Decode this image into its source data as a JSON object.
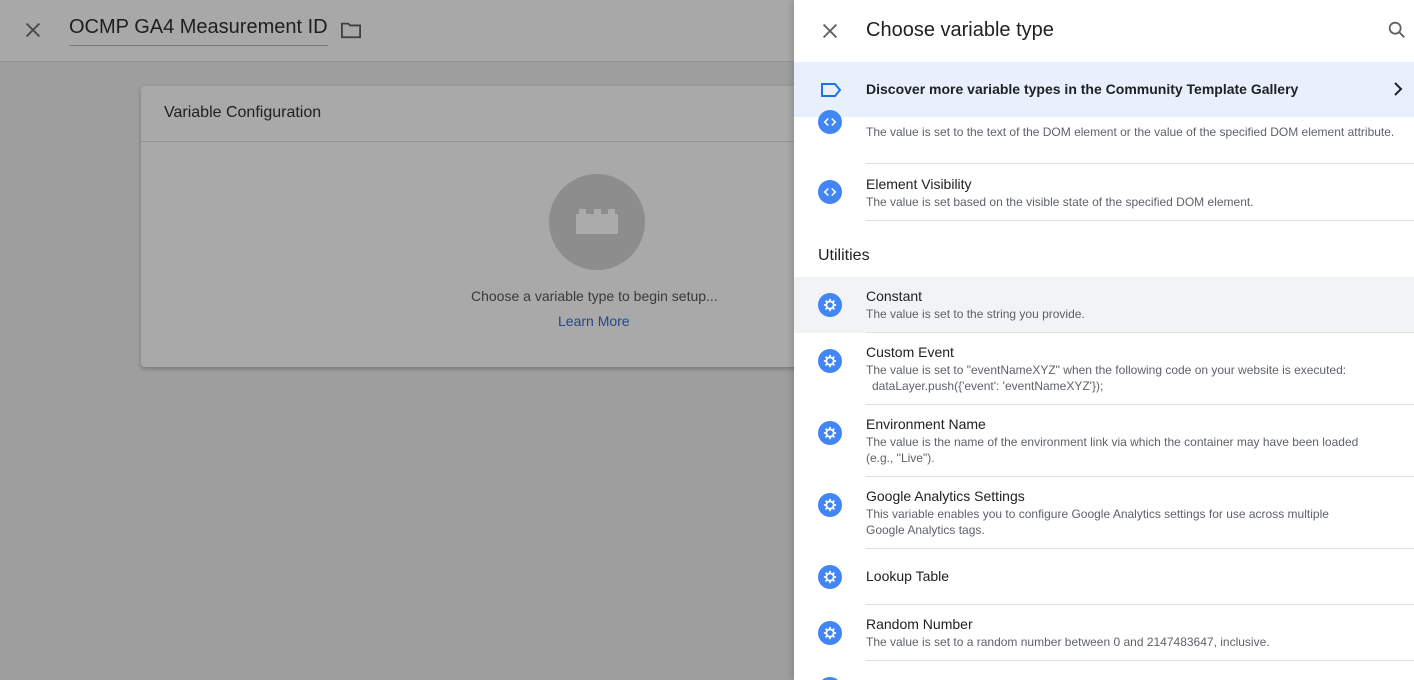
{
  "background": {
    "title": "OCMP GA4 Measurement ID",
    "card_header": "Variable Configuration",
    "hint": "Choose a variable type to begin setup...",
    "learn_more": "Learn More"
  },
  "panel": {
    "title": "Choose variable type",
    "banner": "Discover more variable types in the Community Template Gallery",
    "top_items": [
      {
        "name": "",
        "desc": "The value is set to the text of the DOM element or the value of the specified DOM element attribute.",
        "icon": "code-icon"
      },
      {
        "name": "Element Visibility",
        "desc": "The value is set based on the visible state of the specified DOM element.",
        "icon": "code-icon"
      }
    ],
    "section": "Utilities",
    "utility_items": [
      {
        "name": "Constant",
        "desc": "The value is set to the string you provide.",
        "icon": "gear-icon"
      },
      {
        "name": "Custom Event",
        "desc": "The value is set to \"eventNameXYZ\" when the following code on your website is executed:",
        "desc2": "dataLayer.push({'event': 'eventNameXYZ'});",
        "icon": "gear-icon"
      },
      {
        "name": "Environment Name",
        "desc": "The value is the name of the environment link via which the container may have been loaded (e.g., \"Live\").",
        "icon": "gear-icon"
      },
      {
        "name": "Google Analytics Settings",
        "desc": "This variable enables you to configure Google Analytics settings for use across multiple Google Analytics tags.",
        "icon": "gear-icon"
      },
      {
        "name": "Lookup Table",
        "desc": "",
        "icon": "gear-icon"
      },
      {
        "name": "Random Number",
        "desc": "The value is set to a random number between 0 and 2147483647, inclusive.",
        "icon": "gear-icon"
      }
    ]
  },
  "colors": {
    "accent": "#4285f4",
    "banner_bg": "#e8f0fe",
    "link": "#24478a"
  }
}
